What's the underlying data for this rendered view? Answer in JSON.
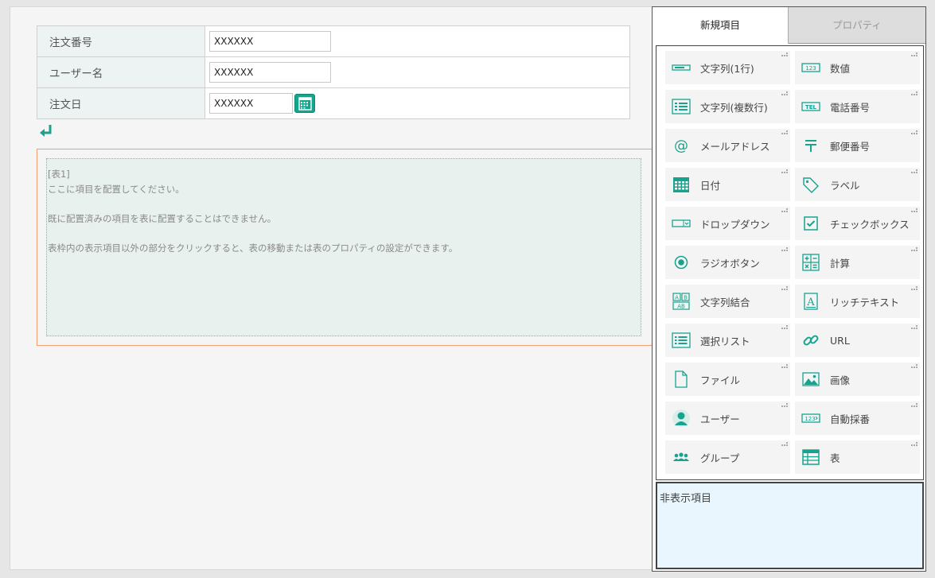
{
  "form": {
    "rows": [
      {
        "label": "注文番号",
        "value": "XXXXXX"
      },
      {
        "label": "ユーザー名",
        "value": "XXXXXX"
      },
      {
        "label": "注文日",
        "value": "XXXXXX"
      }
    ]
  },
  "table_section": {
    "title": "[表1]",
    "line1": "ここに項目を配置してください。",
    "line2": "既に配置済みの項目を表に配置することはできません。",
    "line3": "表枠内の表示項目以外の部分をクリックすると、表の移動または表のプロパティの設定ができます。"
  },
  "panel": {
    "tabs": {
      "new": "新規項目",
      "properties": "プロパティ"
    },
    "items": [
      {
        "label": "文字列(1行)",
        "icon": "single-line-text-icon"
      },
      {
        "label": "数値",
        "icon": "number-icon"
      },
      {
        "label": "文字列(複数行)",
        "icon": "multi-line-text-icon"
      },
      {
        "label": "電話番号",
        "icon": "phone-number-icon"
      },
      {
        "label": "メールアドレス",
        "icon": "email-icon"
      },
      {
        "label": "郵便番号",
        "icon": "postal-code-icon"
      },
      {
        "label": "日付",
        "icon": "date-icon"
      },
      {
        "label": "ラベル",
        "icon": "label-icon"
      },
      {
        "label": "ドロップダウン",
        "icon": "dropdown-icon"
      },
      {
        "label": "チェックボックス",
        "icon": "checkbox-icon"
      },
      {
        "label": "ラジオボタン",
        "icon": "radio-button-icon"
      },
      {
        "label": "計算",
        "icon": "calculation-icon"
      },
      {
        "label": "文字列結合",
        "icon": "string-concat-icon"
      },
      {
        "label": "リッチテキスト",
        "icon": "rich-text-icon"
      },
      {
        "label": "選択リスト",
        "icon": "select-list-icon"
      },
      {
        "label": "URL",
        "icon": "url-icon"
      },
      {
        "label": "ファイル",
        "icon": "file-icon"
      },
      {
        "label": "画像",
        "icon": "image-icon"
      },
      {
        "label": "ユーザー",
        "icon": "user-icon"
      },
      {
        "label": "自動採番",
        "icon": "auto-number-icon"
      },
      {
        "label": "グループ",
        "icon": "group-icon"
      },
      {
        "label": "表",
        "icon": "table-icon"
      }
    ],
    "hidden_items": "非表示項目"
  },
  "colors": {
    "accent": "#17a38e",
    "table_border": "#f0a070",
    "hidden_bg": "#eaf6fe"
  }
}
